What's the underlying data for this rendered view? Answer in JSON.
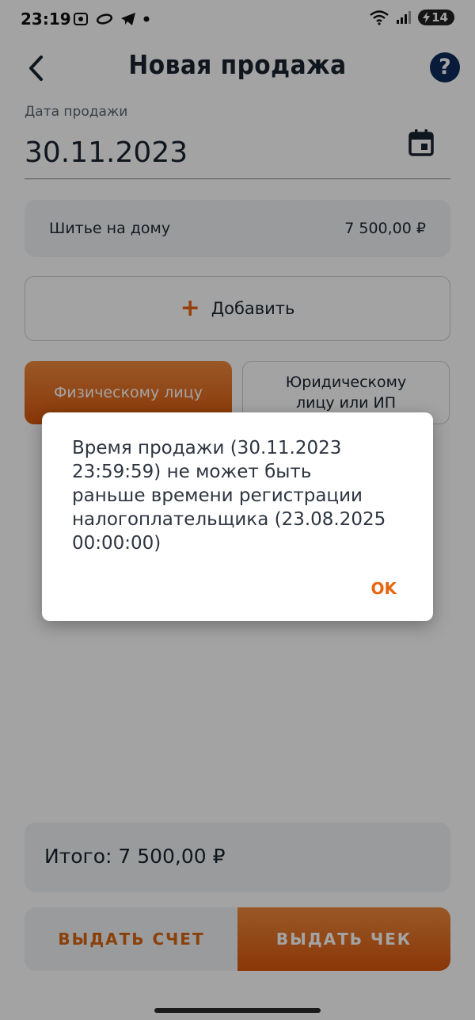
{
  "status_bar": {
    "time": "23:19",
    "battery": "14",
    "icons": [
      "screenshot-icon",
      "link-icon",
      "telegram-icon",
      "notification-dot-icon",
      "wifi-icon",
      "signal-icon",
      "battery-charging-icon"
    ]
  },
  "header": {
    "title": "Новая продажа",
    "help_label": "?"
  },
  "form": {
    "date_label": "Дата продажи",
    "date_value": "30.11.2023"
  },
  "items": [
    {
      "name": "Шитье на дому",
      "price": "7 500,00 ₽"
    }
  ],
  "add_button": {
    "plus": "+",
    "label": "Добавить"
  },
  "buyer_type": {
    "options": [
      "Физическому лицу",
      "Юридическому лицу или ИП"
    ],
    "selected": "Физическому лицу"
  },
  "summary": {
    "total": "Итого: 7 500,00 ₽"
  },
  "actions": {
    "bill_label": "ВЫДАТЬ СЧЕТ",
    "check_label": "ВЫДАТЬ ЧЕК"
  },
  "dialog": {
    "message": "Время продажи (30.11.2023 23:59:59) не может быть раньше времени регистрации налогоплательщика (23.08.2025 00:00:00)",
    "ok_label": "OK"
  },
  "colors": {
    "accent": "#e8650f",
    "help_bg": "#0d2b5c",
    "text": "#1a2330"
  }
}
